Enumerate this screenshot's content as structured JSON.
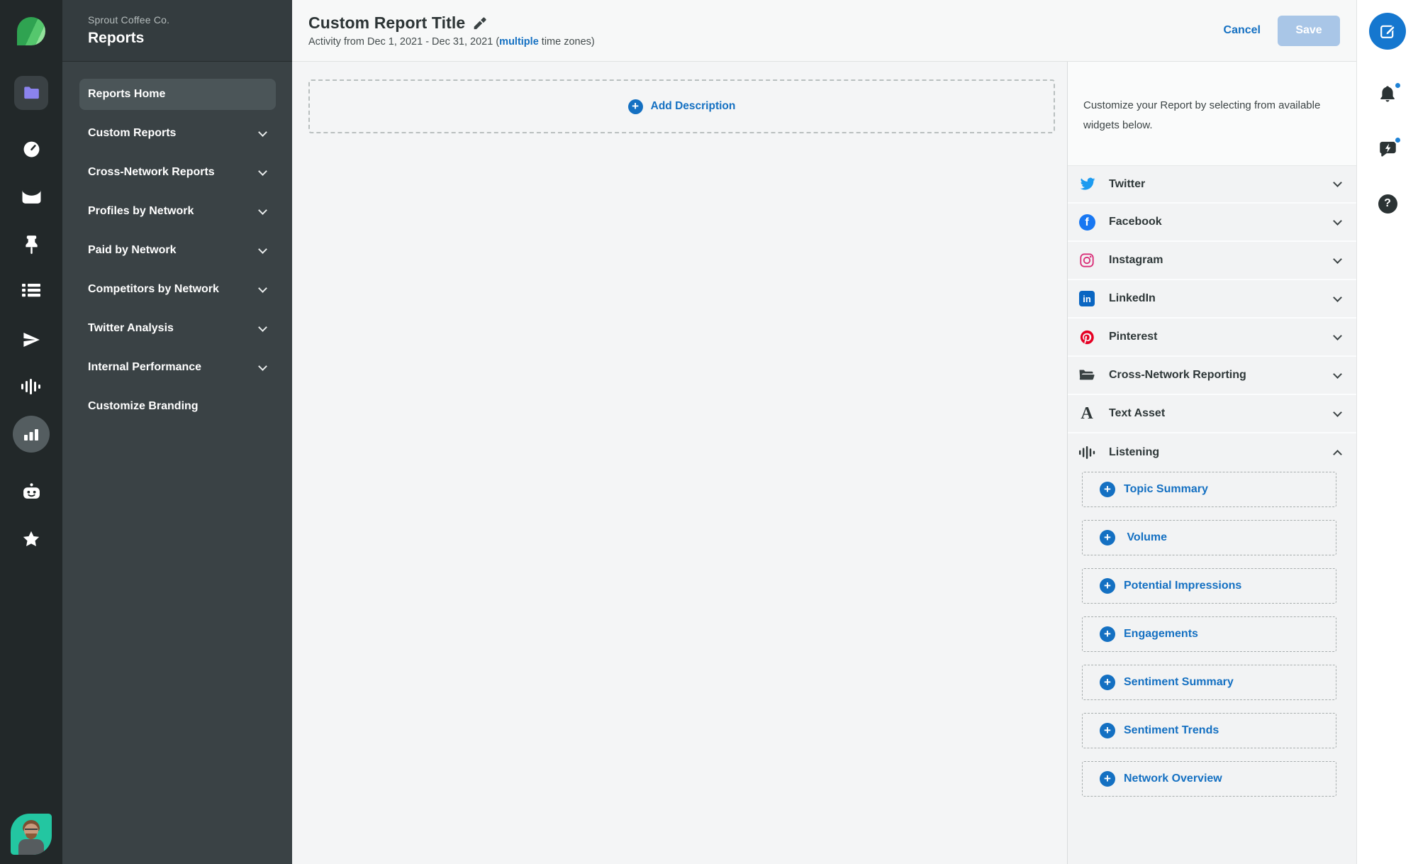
{
  "brand": {
    "company": "Sprout Coffee Co.",
    "app_section": "Reports"
  },
  "left_rail": {
    "icons": [
      "sprout-logo",
      "folder",
      "gauge",
      "inbox",
      "pin",
      "list",
      "send",
      "waveform",
      "bar-chart",
      "robot",
      "star",
      "user-avatar"
    ],
    "active_icon": "bar-chart"
  },
  "sidebar": {
    "items": [
      {
        "label": "Reports Home",
        "selected": true,
        "expandable": false
      },
      {
        "label": "Custom Reports",
        "selected": false,
        "expandable": true
      },
      {
        "label": "Cross-Network Reports",
        "selected": false,
        "expandable": true
      },
      {
        "label": "Profiles by Network",
        "selected": false,
        "expandable": true
      },
      {
        "label": "Paid by Network",
        "selected": false,
        "expandable": true
      },
      {
        "label": "Competitors by Network",
        "selected": false,
        "expandable": true
      },
      {
        "label": "Twitter Analysis",
        "selected": false,
        "expandable": true
      },
      {
        "label": "Internal Performance",
        "selected": false,
        "expandable": true
      },
      {
        "label": "Customize Branding",
        "selected": false,
        "expandable": false
      }
    ]
  },
  "header": {
    "title": "Custom Report Title",
    "subtitle": {
      "prefix": "Activity from Dec 1, 2021 - Dec 31, 2021 (",
      "link": "multiple",
      "suffix": " time zones)"
    },
    "cancel_label": "Cancel",
    "save_label": "Save",
    "save_enabled": false
  },
  "canvas": {
    "add_description_label": "Add Description"
  },
  "panel": {
    "intro": "Customize your Report by selecting from available widgets below.",
    "categories": [
      {
        "label": "Twitter",
        "icon": "twitter-icon",
        "expanded": false
      },
      {
        "label": "Facebook",
        "icon": "facebook-icon",
        "expanded": false
      },
      {
        "label": "Instagram",
        "icon": "instagram-icon",
        "expanded": false
      },
      {
        "label": "LinkedIn",
        "icon": "linkedin-icon",
        "expanded": false
      },
      {
        "label": "Pinterest",
        "icon": "pinterest-icon",
        "expanded": false
      },
      {
        "label": "Cross-Network Reporting",
        "icon": "open-folder-icon",
        "expanded": false
      },
      {
        "label": "Text Asset",
        "icon": "text-asset-icon",
        "expanded": false
      },
      {
        "label": "Listening",
        "icon": "waveform-icon",
        "expanded": true
      }
    ],
    "widgets": [
      {
        "label": "Topic Summary"
      },
      {
        "label": " Volume"
      },
      {
        "label": "Potential Impressions"
      },
      {
        "label": "Engagements"
      },
      {
        "label": "Sentiment Summary"
      },
      {
        "label": "Sentiment Trends"
      },
      {
        "label": "Network Overview"
      }
    ]
  },
  "right_rail": {
    "icons": [
      "compose",
      "notifications-bell",
      "feedback-bubble",
      "help-question"
    ],
    "notification_dots": [
      "notifications-bell",
      "feedback-bubble"
    ]
  },
  "colors": {
    "accent_blue": "#1470c2",
    "compose_blue": "#1577cf",
    "save_disabled": "#a9c6e7",
    "sprout_green": "#3bb35c",
    "rail_dark": "#222829",
    "sidebar_dark": "#3a4245",
    "avatar_teal": "#23c6a1",
    "twitter": "#1d9bf0",
    "facebook": "#1877f2",
    "instagram": "#d92d77",
    "linkedin": "#0a66c2",
    "pinterest": "#e60023"
  }
}
